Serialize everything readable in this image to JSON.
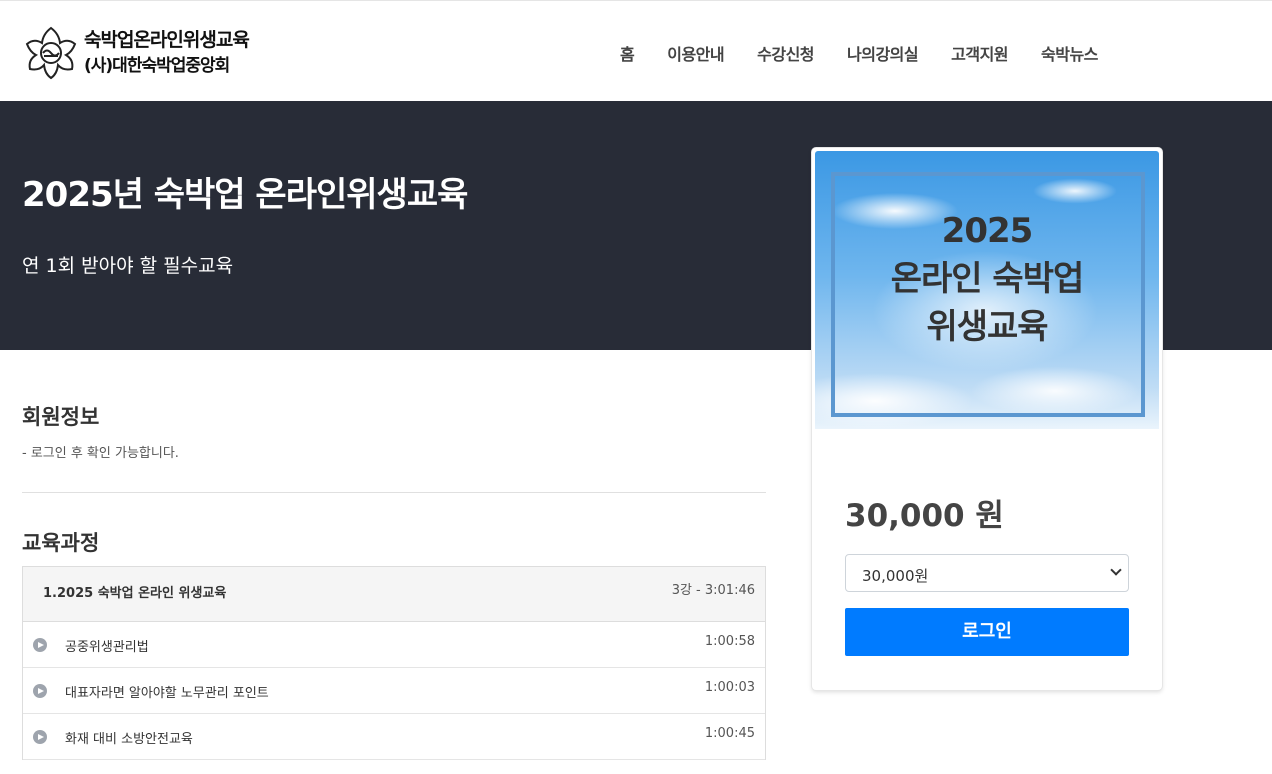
{
  "header": {
    "logo_title": "숙박업온라인위생교육",
    "logo_subtitle": "(사)대한숙박업중앙회",
    "nav": [
      "홈",
      "이용안내",
      "수강신청",
      "나의강의실",
      "고객지원",
      "숙박뉴스"
    ]
  },
  "hero": {
    "title": "2025년 숙박업 온라인위생교육",
    "subtitle": "연 1회 받아야 할 필수교육"
  },
  "member": {
    "title": "회원정보",
    "note": "- 로그인 후 확인 가능합니다."
  },
  "course": {
    "title": "교육과정",
    "group_title": "1.2025 숙박업 온라인 위생교육",
    "group_meta": "3강 - 3:01:46",
    "lessons": [
      {
        "title": "공중위생관리법",
        "time": "1:00:58"
      },
      {
        "title": "대표자라면 알아야할 노무관리 포인트",
        "time": "1:00:03"
      },
      {
        "title": "화재 대비 소방안전교육",
        "time": "1:00:45"
      }
    ]
  },
  "card": {
    "thumb_line1": "2025",
    "thumb_line2": "온라인 숙박업",
    "thumb_line3": "위생교육",
    "price": "30,000 원",
    "select_value": "30,000원",
    "login_label": "로그인"
  }
}
